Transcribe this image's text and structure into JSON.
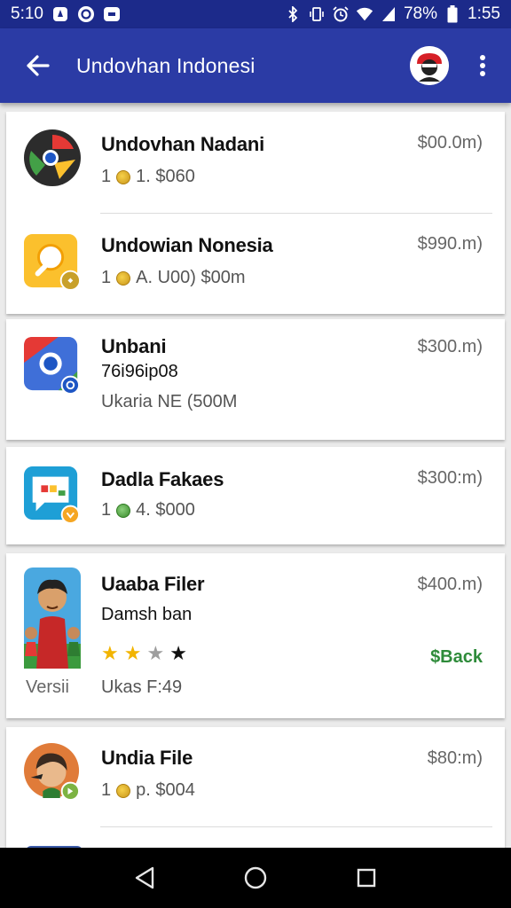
{
  "status_bar": {
    "time_left": "5:10",
    "battery": "78%",
    "time_right": "1:55",
    "icons_left": [
      "notification-icon",
      "sync-icon",
      "message-icon"
    ],
    "icons_right": [
      "bluetooth-icon",
      "vibrate-icon",
      "alarm-icon",
      "wifi-icon",
      "signal-icon",
      "battery-icon"
    ]
  },
  "app_bar": {
    "title": "Undovhan Indonesi",
    "back_icon": "arrow-left-icon",
    "avatar_icon": "profile-avatar-icon",
    "menu_icon": "more-vert-icon"
  },
  "items": [
    {
      "title": "Undovhan Nadani",
      "price": "$00.0m)",
      "meta_prefix": "1",
      "meta_text": "1. $060",
      "icon": "chrome-icon"
    },
    {
      "title": "Undowian Nonesia",
      "price": "$990.m)",
      "meta_prefix": "1",
      "meta_text": "A. U00) $00m",
      "icon": "magnifier-app-icon"
    },
    {
      "title": "Unbani",
      "price": "$300.m)",
      "line2": "76i96ip08",
      "line3": "Ukaria NE (500M",
      "icon": "chrome-blue-icon"
    },
    {
      "title": "Dadla Fakaes",
      "price": "$300:m)",
      "meta_prefix": "1",
      "meta_text": "4. $000",
      "icon": "chat-app-icon"
    },
    {
      "title": "Uaaba Filer",
      "price": "$400.m)",
      "line2": "Damsh ban",
      "rating": 3,
      "rating_max": 4,
      "action": "$Back",
      "version_label": "Versii",
      "line3": "Ukas F:49",
      "icon": "character-avatar-icon"
    },
    {
      "title": "Undia File",
      "price": "$80:m)",
      "meta_prefix": "1",
      "meta_text": "p. $004",
      "icon": "person-avatar-icon"
    }
  ],
  "nav_bar": {
    "back_icon": "nav-back-icon",
    "home_icon": "nav-home-icon",
    "recents_icon": "nav-recents-icon"
  },
  "colors": {
    "app_bar": "#2b3ba5",
    "status_bar": "#1c2a8a",
    "accent_green": "#2e8b3a",
    "star_gold": "#f2b400"
  }
}
